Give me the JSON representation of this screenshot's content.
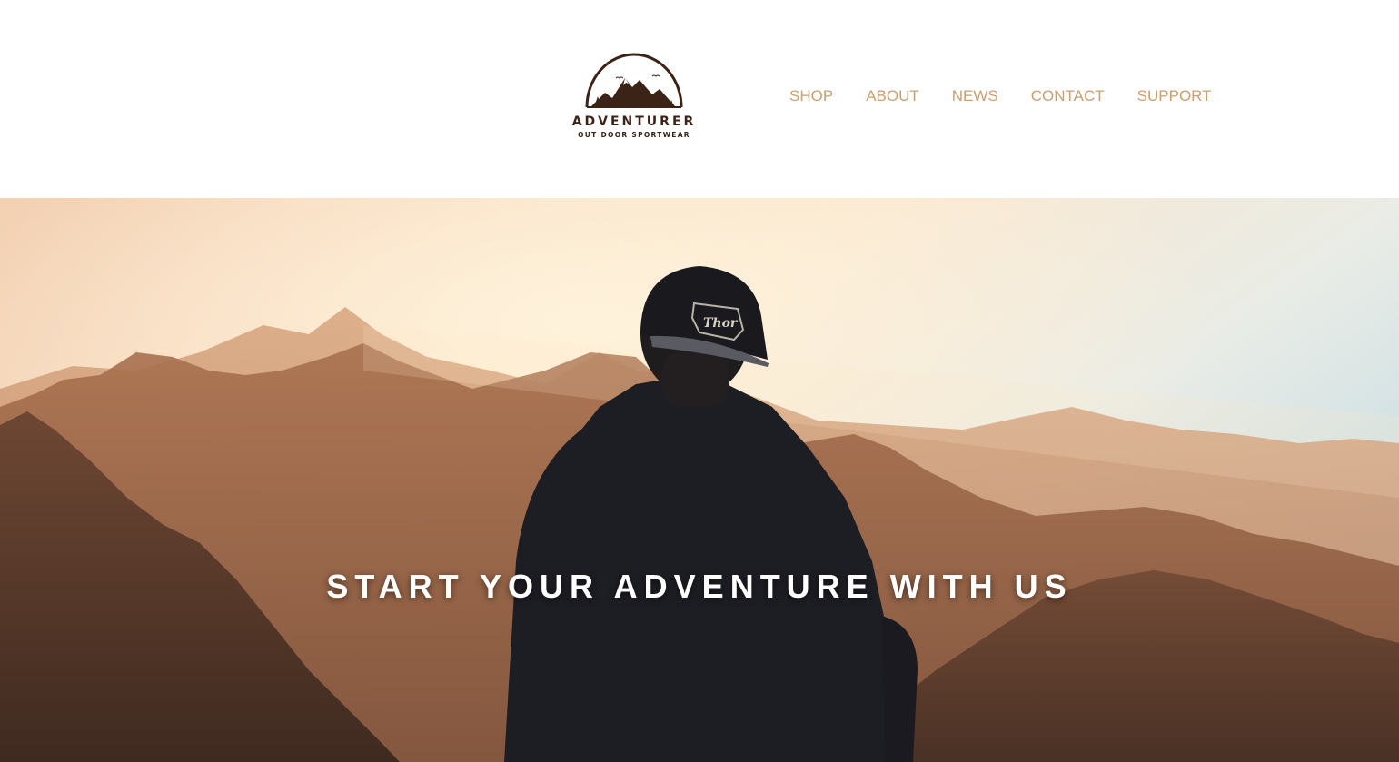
{
  "header": {
    "logo": {
      "name": "ADVENTURER",
      "tagline": "OUT DOOR SPORTWEAR"
    },
    "nav": [
      {
        "label": "SHOP"
      },
      {
        "label": "ABOUT"
      },
      {
        "label": "NEWS"
      },
      {
        "label": "CONTACT"
      },
      {
        "label": "SUPPORT"
      }
    ]
  },
  "hero": {
    "title": "START YOUR ADVENTURE WITH US",
    "cap_text": "Thor"
  },
  "colors": {
    "nav_text": "#c9a070",
    "logo_brown": "#3b2417",
    "hero_title": "#ffffff"
  }
}
